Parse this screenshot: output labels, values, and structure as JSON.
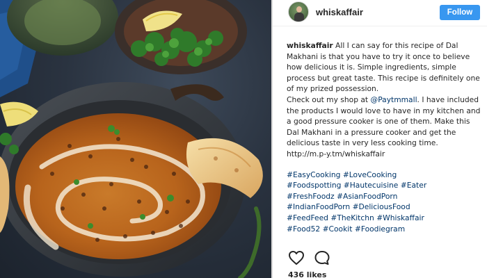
{
  "post": {
    "username": "whiskaffair",
    "follow_label": "Follow",
    "caption": {
      "username": "whiskaffair",
      "text_1": " All I can say for this recipe of Dal Makhani is that you have to try it once to believe how delicious it is. Simple ingredients, simple process but great taste. This recipe is definitely one of my prized possession.",
      "text_2a": "Check out my shop at ",
      "mention": "@Paytmmall",
      "text_2b": ". I have included the products I would love to have in my kitchen and a good pressure cooker is one of them. Make this Dal Makhani in a pressure cooker and get the delicious taste in very less cooking time.",
      "link": "http://m.p-y.tm/whiskaffair"
    },
    "hashtag_lines": [
      [
        "#EasyCooking",
        "#LoveCooking"
      ],
      [
        "#Foodspotting",
        "#Hautecuisine",
        "#Eater"
      ],
      [
        "#FreshFoodz",
        "#AsianFoodPorn"
      ],
      [
        "#IndianFoodPorn",
        "#DeliciousFood"
      ],
      [
        "#FeedFeed",
        "#TheKitchn",
        "#Whiskaffair"
      ],
      [
        "#Food52",
        "#Cookit",
        "#Foodiegram"
      ]
    ],
    "likes": "436 likes",
    "icons": {
      "like": "heart-icon",
      "comment": "comment-icon"
    },
    "colors": {
      "follow_button": "#3897f0",
      "hashtag": "#003569",
      "text": "#262626"
    }
  }
}
